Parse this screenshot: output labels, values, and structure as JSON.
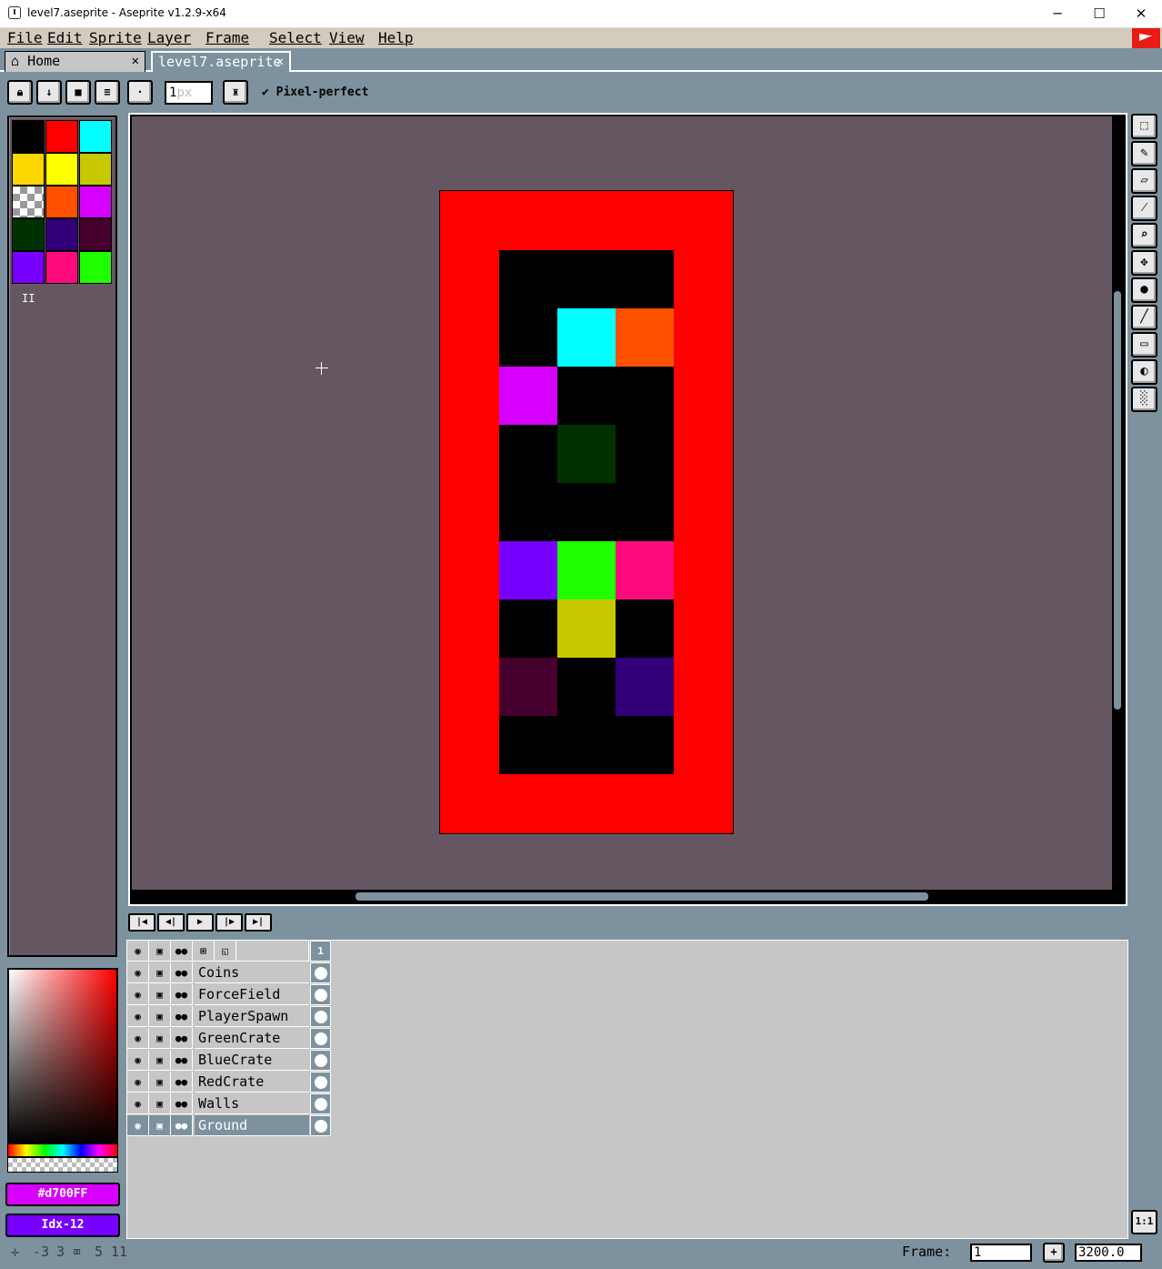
{
  "window": {
    "title": "level7.aseprite - Aseprite v1.2.9-x64",
    "controls": {
      "minimize": "─",
      "maximize": "☐",
      "close": "✕"
    }
  },
  "menu": [
    "File",
    "Edit",
    "Sprite",
    "Layer",
    "Frame",
    "Select",
    "View",
    "Help"
  ],
  "tabs": [
    {
      "label": "Home",
      "icon": "home-icon"
    },
    {
      "label": "level7.aseprite"
    }
  ],
  "toolbar": {
    "brush_size": "1",
    "brush_unit": "px",
    "pixel_perfect_label": "Pixel-perfect"
  },
  "palette": {
    "colors": [
      "#000000",
      "#ff0000",
      "#00ffff",
      "#ffd700",
      "#ffff00",
      "#c8c800",
      "transparent",
      "#ff5000",
      "#d700ff",
      "#003200",
      "#320078",
      "#46002d",
      "#7800ff",
      "#ff0a7d",
      "#1eff00"
    ],
    "page_indicator": "II"
  },
  "colors": {
    "foreground_label": "#d700FF",
    "foreground_color": "#d700ff",
    "background_label": "Idx-12",
    "background_color": "#7800ff",
    "canvas_bg": "#655761",
    "ui_blue": "#7d929e"
  },
  "sprite": {
    "border_color": "#ff0000",
    "inner_color": "#000000",
    "cells": [
      {
        "col": 1,
        "row": 1,
        "color": "#00ffff"
      },
      {
        "col": 2,
        "row": 1,
        "color": "#ff5000"
      },
      {
        "col": 0,
        "row": 2,
        "color": "#d700ff"
      },
      {
        "col": 1,
        "row": 3,
        "color": "#003200"
      },
      {
        "col": 0,
        "row": 5,
        "color": "#7800ff"
      },
      {
        "col": 1,
        "row": 5,
        "color": "#1eff00"
      },
      {
        "col": 2,
        "row": 5,
        "color": "#ff0a7d"
      },
      {
        "col": 1,
        "row": 6,
        "color": "#c8c800"
      },
      {
        "col": 0,
        "row": 7,
        "color": "#46002d"
      },
      {
        "col": 2,
        "row": 7,
        "color": "#320078"
      }
    ]
  },
  "timeline": {
    "frame_header": "1",
    "layers": [
      "Coins",
      "ForceField",
      "PlayerSpawn",
      "GreenCrate",
      "BlueCrate",
      "RedCrate",
      "Walls",
      "Ground"
    ],
    "active_layer": "Ground"
  },
  "status": {
    "cursor_x": "-3",
    "cursor_y": "3",
    "sel_w": "5",
    "sel_h": "11",
    "frame_label": "Frame:",
    "frame_value": "1",
    "add_frame": "+",
    "zoom_value": "3200.0",
    "one_to_one": "1:1"
  }
}
